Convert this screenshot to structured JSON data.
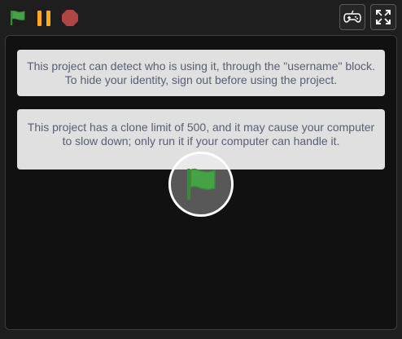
{
  "controls": {
    "green_flag_icon": "green-flag-icon",
    "pause_icon": "pause-icon",
    "stop_icon": "stop-icon",
    "gamepad_icon": "gamepad-icon",
    "fullscreen_icon": "fullscreen-icon"
  },
  "alerts": [
    {
      "text": "This project can detect who is using it, through the \"username\" block. To hide your identity, sign out before using the project."
    },
    {
      "text": "This project has a clone limit of 500, and it may cause your computer to slow down; only run it if your computer can handle it."
    }
  ],
  "colors": {
    "flag_green": "#45a245",
    "pause_orange": "#ffab19",
    "stop_red": "#b04545",
    "alert_bg": "#e0e0e0",
    "alert_text": "#575e75",
    "stage_bg": "#111111",
    "window_bg": "#1e1e1e"
  }
}
